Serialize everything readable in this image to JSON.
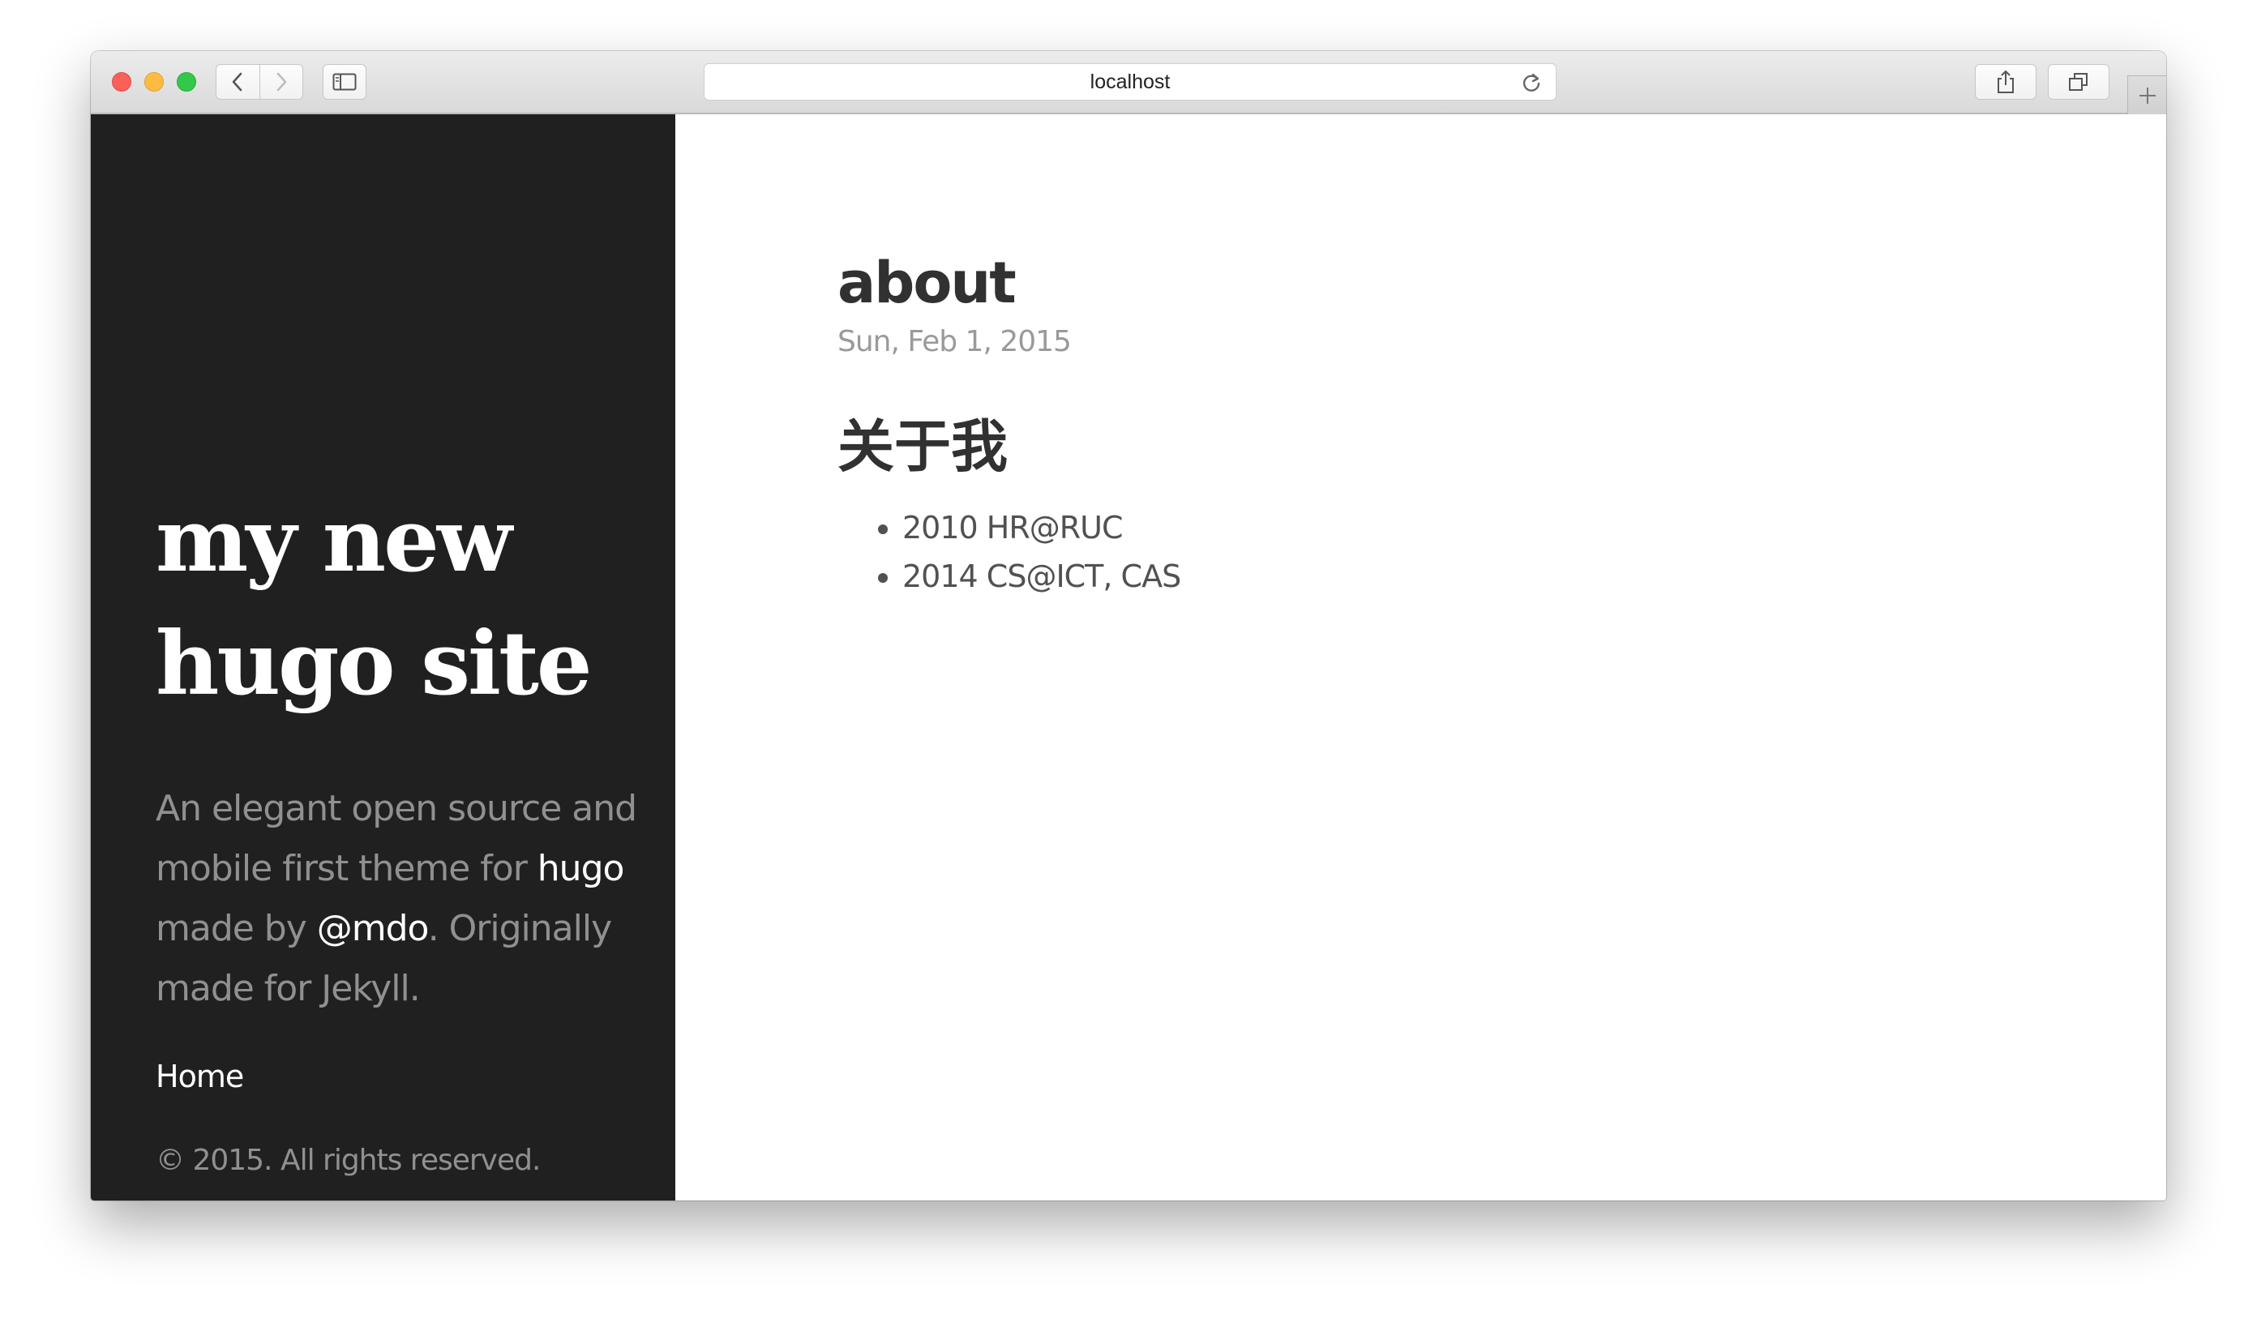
{
  "browser": {
    "url": "localhost",
    "back_icon": "chevron-left-icon",
    "forward_icon": "chevron-right-icon",
    "sidebar_icon": "sidebar-icon",
    "reload_icon": "reload-icon",
    "share_icon": "share-icon",
    "tabs_icon": "tabs-icon",
    "new_tab_icon": "plus-icon"
  },
  "sidebar": {
    "title_line1": "my new",
    "title_line2": "hugo site",
    "lead_part1": "An elegant open source and mobile first theme for ",
    "lead_link1": "hugo",
    "lead_part2": " made by ",
    "lead_link2": "@mdo",
    "lead_part3": ". Originally made for Jekyll.",
    "nav_home": "Home",
    "copyright": "© 2015. All rights reserved."
  },
  "post": {
    "title": "about",
    "date": "Sun, Feb 1, 2015",
    "heading": "关于我",
    "items": [
      "2010 HR@RUC",
      "2014 CS@ICT, CAS"
    ]
  },
  "colors": {
    "sidebar_bg": "#202020",
    "heading_text": "#313131",
    "body_text": "#515151",
    "muted_text": "#9a9a9a"
  }
}
